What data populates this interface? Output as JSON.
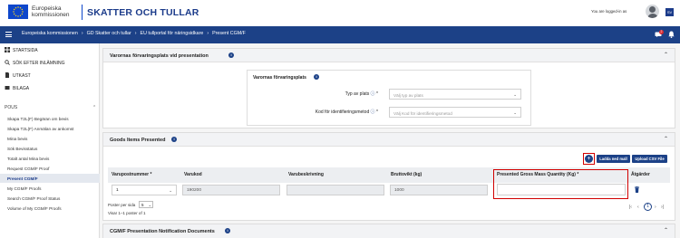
{
  "header": {
    "eu_line1": "Europeiska",
    "eu_line2": "kommissionen",
    "site_title": "SKATTER OCH TULLAR",
    "logged_in_text": "You are logged-in as",
    "lang": "SV",
    "brand_color": "#1c4187"
  },
  "navbar": {
    "breadcrumb": [
      "Europeiska kommissionen",
      "GD Skatter och tullar",
      "EU tullportal för näringsidkare",
      "Present CGM/F"
    ],
    "message_count": "2"
  },
  "sidebar": {
    "main_items": [
      {
        "label": "STARTSIDA",
        "icon": "grid-icon"
      },
      {
        "label": "SÖK EFTER INLÄMNING",
        "icon": "search-icon"
      },
      {
        "label": "UTKAST",
        "icon": "document-icon"
      },
      {
        "label": "BILAGA",
        "icon": "paperclip-icon"
      }
    ],
    "section_label": "POUS",
    "sub_items": [
      {
        "label": "Skapa T2L(F) Begäran om bevis",
        "active": false
      },
      {
        "label": "Skapa T2L(F) Anmälan av ankomst",
        "active": false
      },
      {
        "label": "Mina bevis",
        "active": false
      },
      {
        "label": "Sök Bevisstatus",
        "active": false
      },
      {
        "label": "Totalt antal Mina bevis",
        "active": false
      },
      {
        "label": "Request CGM/F Proof",
        "active": false
      },
      {
        "label": "Present CGM/F",
        "active": true
      },
      {
        "label": "My CGM/F Proofs",
        "active": false
      },
      {
        "label": "Search CGM/F Proof Status",
        "active": false
      },
      {
        "label": "Volume of My CGM/F Proofs",
        "active": false
      }
    ]
  },
  "storage": {
    "title": "Varornas förvaringsplats vid presentation",
    "sub_title": "Varornas förvaringsplats",
    "type_label": "Typ av plats",
    "type_placeholder": "Välj typ av plats",
    "qualifier_label": "Kod för identifieringsmetod",
    "qualifier_placeholder": "Välj Kod för identifieringsmetod"
  },
  "goods": {
    "title": "Goods Items Presented",
    "btn_template": "Ladda ned mall",
    "btn_upload": "Upload CSV File",
    "columns": [
      "Varupostnummer *",
      "Varukod",
      "Varubeskrivning",
      "Bruttovikt (kg)",
      "Presented Gross Mass Quantity (Kg) *",
      "Åtgärder"
    ],
    "row": {
      "item_number": "1",
      "commodity_code": "190200",
      "description": "",
      "gross_mass": "1000",
      "presented_mass": ""
    },
    "per_page_label": "Poster per sida",
    "per_page_value": "5",
    "showing": "Visar 1–1 poster of 1",
    "current_page": "1"
  },
  "notifications": {
    "title": "CGM/F Presentation Notification Documents"
  }
}
